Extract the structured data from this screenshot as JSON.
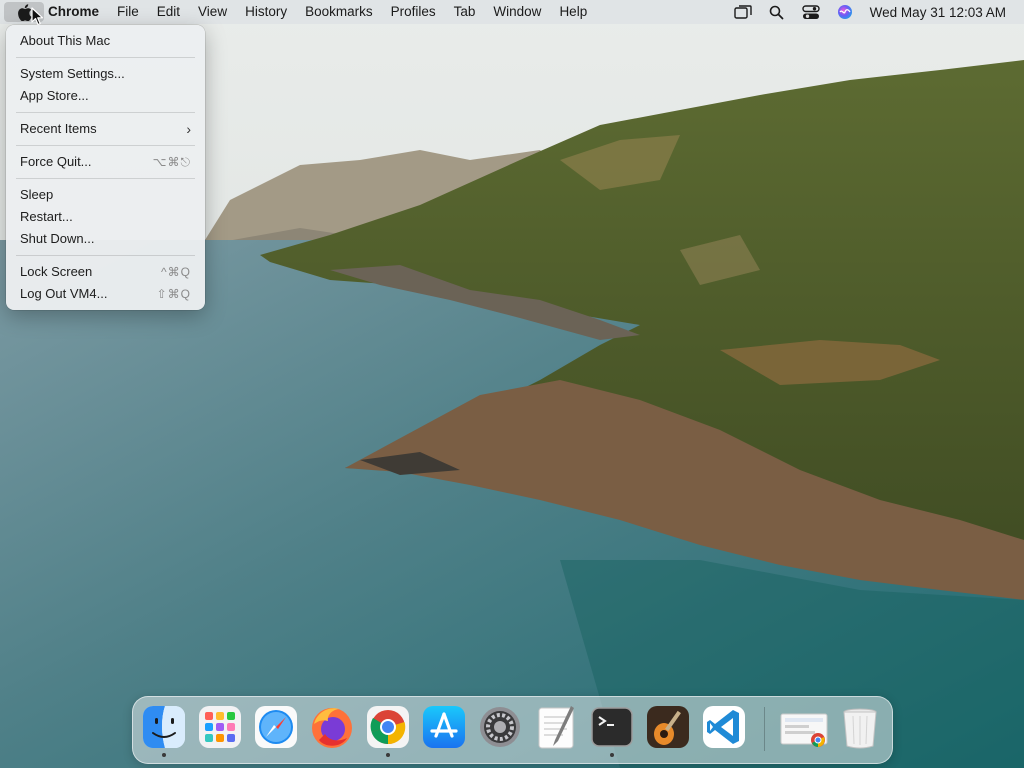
{
  "menubar": {
    "app_name": "Chrome",
    "menus": [
      "File",
      "Edit",
      "View",
      "History",
      "Bookmarks",
      "Profiles",
      "Tab",
      "Window",
      "Help"
    ],
    "status_icons": [
      "mission-control-icon",
      "spotlight-search-icon",
      "control-center-icon",
      "siri-icon"
    ],
    "clock": "Wed May 31  12:03 AM"
  },
  "apple_menu": {
    "items": [
      {
        "label": "About This Mac",
        "shortcut": ""
      },
      {
        "label": "System Settings...",
        "shortcut": ""
      },
      {
        "label": "App Store...",
        "shortcut": ""
      },
      {
        "label": "Recent Items",
        "shortcut": "",
        "submenu": true
      },
      {
        "label": "Force Quit...",
        "shortcut": "⌥⌘⎋"
      },
      {
        "label": "Sleep",
        "shortcut": ""
      },
      {
        "label": "Restart...",
        "shortcut": ""
      },
      {
        "label": "Shut Down...",
        "shortcut": ""
      },
      {
        "label": "Lock Screen",
        "shortcut": "^⌘Q"
      },
      {
        "label": "Log Out VM4...",
        "shortcut": "⇧⌘Q"
      }
    ]
  },
  "dock": {
    "apps": [
      {
        "name": "Finder",
        "icon": "finder-icon",
        "running": true
      },
      {
        "name": "Launchpad",
        "icon": "launchpad-icon",
        "running": false
      },
      {
        "name": "Safari",
        "icon": "safari-icon",
        "running": false
      },
      {
        "name": "Firefox",
        "icon": "firefox-icon",
        "running": false
      },
      {
        "name": "Google Chrome",
        "icon": "chrome-icon",
        "running": true
      },
      {
        "name": "App Store",
        "icon": "app-store-icon",
        "running": false
      },
      {
        "name": "System Settings",
        "icon": "system-settings-icon",
        "running": false
      },
      {
        "name": "TextEdit",
        "icon": "textedit-icon",
        "running": false
      },
      {
        "name": "Terminal",
        "icon": "terminal-icon",
        "running": true
      },
      {
        "name": "GarageBand",
        "icon": "garageband-icon",
        "running": false
      },
      {
        "name": "Visual Studio Code",
        "icon": "vscode-icon",
        "running": false
      }
    ],
    "others": [
      {
        "name": "Chrome Downloads",
        "icon": "chrome-folder-icon"
      },
      {
        "name": "Trash",
        "icon": "trash-icon"
      }
    ]
  }
}
